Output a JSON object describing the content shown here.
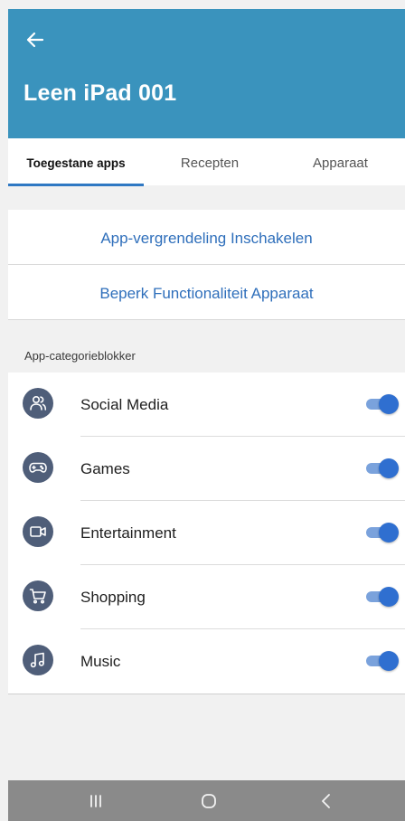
{
  "header": {
    "title": "Leen iPad 001"
  },
  "tabs": [
    {
      "label": "Toegestane apps",
      "active": true
    },
    {
      "label": "Recepten",
      "active": false
    },
    {
      "label": "Apparaat",
      "active": false
    }
  ],
  "actions": {
    "app_lock": "App-vergrendeling Inschakelen",
    "restrict": "Beperk Functionaliteit Apparaat"
  },
  "section": {
    "label": "App-categorieblokker"
  },
  "categories": [
    {
      "label": "Social Media",
      "icon": "people-icon",
      "enabled": true
    },
    {
      "label": "Games",
      "icon": "gamepad-icon",
      "enabled": true
    },
    {
      "label": "Entertainment",
      "icon": "video-camera-icon",
      "enabled": true
    },
    {
      "label": "Shopping",
      "icon": "shopping-cart-icon",
      "enabled": true
    },
    {
      "label": "Music",
      "icon": "music-note-icon",
      "enabled": true
    }
  ],
  "colors": {
    "header": "#3a93bd",
    "accent": "#2f78c3",
    "toggle_on": "#2f6fd0",
    "icon_bg": "#4f5e79",
    "navbar": "#8a8a8a"
  }
}
